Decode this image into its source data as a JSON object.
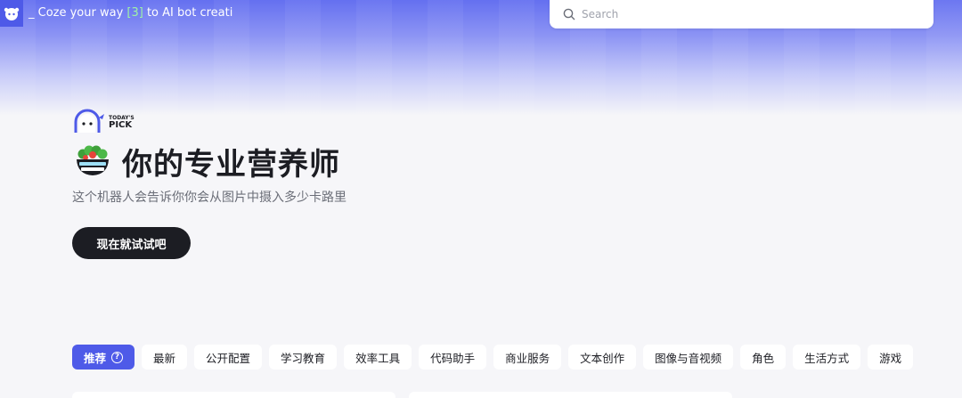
{
  "topbar": {
    "tagline_prefix": "_ Coze your way ",
    "tagline_highlight": "[3]",
    "tagline_suffix": " to AI bot creati"
  },
  "search": {
    "placeholder": "Search"
  },
  "badge": {
    "small": "TODAY'S",
    "big": "PICK"
  },
  "featured": {
    "title": "你的专业营养师",
    "description": "这个机器人会告诉你你会从图片中摄入多少卡路里",
    "try_label": "现在就试试吧"
  },
  "tabs": [
    {
      "label": "推荐",
      "active": true,
      "has_help_icon": true
    },
    {
      "label": "最新"
    },
    {
      "label": "公开配置"
    },
    {
      "label": "学习教育"
    },
    {
      "label": "效率工具"
    },
    {
      "label": "代码助手"
    },
    {
      "label": "商业服务"
    },
    {
      "label": "文本创作"
    },
    {
      "label": "图像与音视频"
    },
    {
      "label": "角色"
    },
    {
      "label": "生活方式"
    },
    {
      "label": "游戏"
    }
  ],
  "colors": {
    "accent": "#4e5ae8",
    "button_dark": "#1c1d23",
    "tagline_highlight": "#9ef3a6"
  },
  "icons": [
    "coze-logo-icon",
    "search-icon",
    "today-pick-icon",
    "salad-bowl-icon",
    "help-circle-icon"
  ]
}
